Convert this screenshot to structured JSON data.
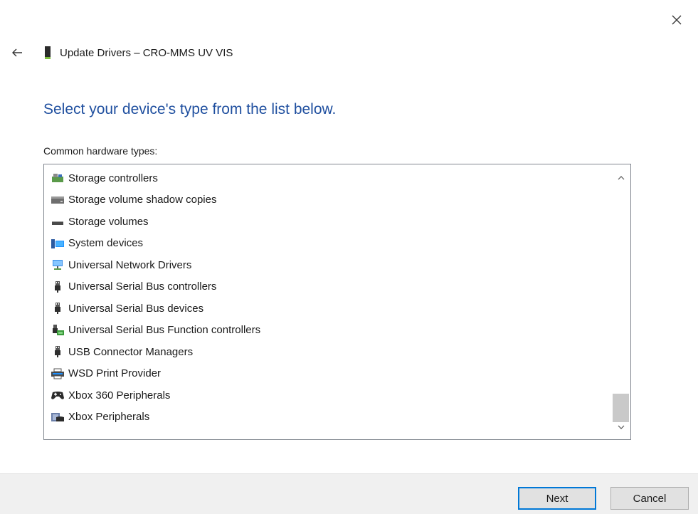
{
  "window": {
    "title": "Update Drivers – CRO-MMS UV VIS"
  },
  "instruction": "Select your device's type from the list below.",
  "list_label": "Common hardware types:",
  "hardware_types": [
    {
      "label": "Storage controllers",
      "icon": "storage-controller-icon"
    },
    {
      "label": "Storage volume shadow copies",
      "icon": "drive-icon"
    },
    {
      "label": "Storage volumes",
      "icon": "volume-icon"
    },
    {
      "label": "System devices",
      "icon": "system-devices-icon"
    },
    {
      "label": "Universal Network Drivers",
      "icon": "network-icon"
    },
    {
      "label": "Universal Serial Bus controllers",
      "icon": "usb-icon"
    },
    {
      "label": "Universal Serial Bus devices",
      "icon": "usb-icon"
    },
    {
      "label": "Universal Serial Bus Function controllers",
      "icon": "usb-function-icon"
    },
    {
      "label": "USB Connector Managers",
      "icon": "usb-icon"
    },
    {
      "label": "WSD Print Provider",
      "icon": "printer-icon"
    },
    {
      "label": "Xbox 360 Peripherals",
      "icon": "gamepad-icon"
    },
    {
      "label": "Xbox Peripherals",
      "icon": "xbox-peripherals-icon"
    }
  ],
  "buttons": {
    "next": "Next",
    "cancel": "Cancel"
  },
  "colors": {
    "heading": "#1f4f9f",
    "focus_border": "#0078d7",
    "footer_bg": "#f0f0f0"
  }
}
